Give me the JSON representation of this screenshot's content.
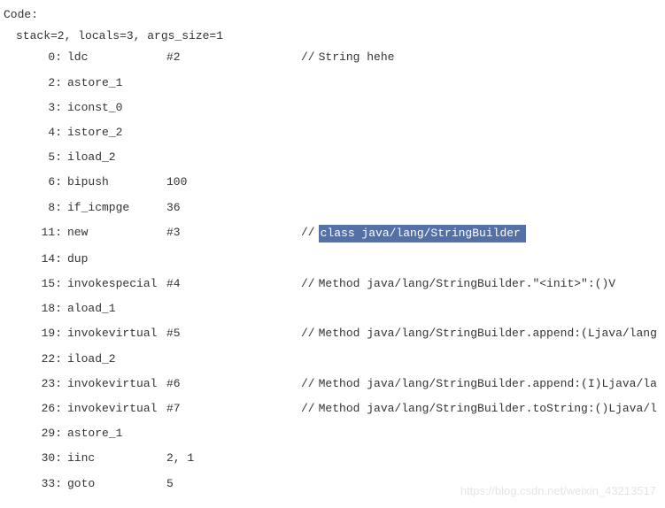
{
  "header": "Code:",
  "stack_info": "stack=2, locals=3, args_size=1",
  "lines": [
    {
      "offset": "0:",
      "opcode": "ldc",
      "operand": "#2",
      "comment": "String hehe",
      "highlighted": false
    },
    {
      "offset": "2:",
      "opcode": "astore_1",
      "operand": "",
      "comment": "",
      "highlighted": false
    },
    {
      "offset": "3:",
      "opcode": "iconst_0",
      "operand": "",
      "comment": "",
      "highlighted": false
    },
    {
      "offset": "4:",
      "opcode": "istore_2",
      "operand": "",
      "comment": "",
      "highlighted": false
    },
    {
      "offset": "5:",
      "opcode": "iload_2",
      "operand": "",
      "comment": "",
      "highlighted": false
    },
    {
      "offset": "6:",
      "opcode": "bipush",
      "operand": "100",
      "comment": "",
      "highlighted": false
    },
    {
      "offset": "8:",
      "opcode": "if_icmpge",
      "operand": "36",
      "comment": "",
      "highlighted": false
    },
    {
      "offset": "11:",
      "opcode": "new",
      "operand": "#3",
      "comment": "class java/lang/StringBuilder",
      "highlighted": true
    },
    {
      "offset": "14:",
      "opcode": "dup",
      "operand": "",
      "comment": "",
      "highlighted": false
    },
    {
      "offset": "15:",
      "opcode": "invokespecial",
      "operand": "#4",
      "comment": "Method java/lang/StringBuilder.\"<init>\":()V",
      "highlighted": false
    },
    {
      "offset": "18:",
      "opcode": "aload_1",
      "operand": "",
      "comment": "",
      "highlighted": false
    },
    {
      "offset": "19:",
      "opcode": "invokevirtual",
      "operand": "#5",
      "comment": "Method java/lang/StringBuilder.append:(Ljava/lang",
      "highlighted": false
    },
    {
      "offset": "22:",
      "opcode": "iload_2",
      "operand": "",
      "comment": "",
      "highlighted": false
    },
    {
      "offset": "23:",
      "opcode": "invokevirtual",
      "operand": "#6",
      "comment": "Method java/lang/StringBuilder.append:(I)Ljava/la",
      "highlighted": false
    },
    {
      "offset": "26:",
      "opcode": "invokevirtual",
      "operand": "#7",
      "comment": "Method java/lang/StringBuilder.toString:()Ljava/l",
      "highlighted": false
    },
    {
      "offset": "29:",
      "opcode": "astore_1",
      "operand": "",
      "comment": "",
      "highlighted": false
    },
    {
      "offset": "30:",
      "opcode": "iinc",
      "operand": "2, 1",
      "comment": "",
      "highlighted": false
    },
    {
      "offset": "33:",
      "opcode": "goto",
      "operand": "5",
      "comment": "",
      "highlighted": false
    }
  ],
  "watermark": "https://blog.csdn.net/weixin_43213517"
}
